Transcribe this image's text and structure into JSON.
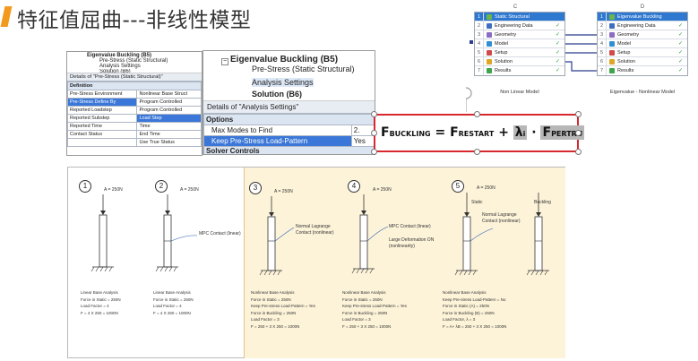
{
  "title": "特征值屈曲---非线性模型",
  "left_panel": {
    "tree": [
      "Eigenvalue Buckling (B5)",
      "Pre-Stress (Static Structural)",
      "Analysis Settings",
      "Solution (B6)"
    ],
    "details_title": "Details of \"Pre-Stress (Static Structural)\"",
    "section": "Definition",
    "rows": [
      [
        "Pre-Stress Environment",
        "Nonlinear Base Struct"
      ],
      [
        "Pre-Stress Define By",
        "Program Controlled"
      ],
      [
        "Reported Loadstep",
        "Program Controlled"
      ],
      [
        "Reported Substep",
        "Load Step"
      ],
      [
        "Reported Time",
        "Time"
      ],
      [
        "Contact Status",
        "End Time"
      ],
      [
        "",
        "Use True Status"
      ]
    ]
  },
  "middle_panel": {
    "tree": [
      "Eigenvalue Buckling (B5)",
      "Pre-Stress (Static Structural)",
      "Analysis Settings",
      "Solution (B6)"
    ],
    "details_title": "Details of \"Analysis Settings\"",
    "section": "Options",
    "rows": [
      [
        "Max Modes to Find",
        "2."
      ],
      [
        "Keep Pre-Stress Load-Pattern",
        "Yes"
      ]
    ],
    "section2": "Solver Controls"
  },
  "workflow": {
    "col_c": "C",
    "col_d": "D",
    "system_c": {
      "title": "Static Structural",
      "rows": [
        {
          "n": "1",
          "label": "Static Structural"
        },
        {
          "n": "2",
          "label": "Engineering Data"
        },
        {
          "n": "3",
          "label": "Geometry"
        },
        {
          "n": "4",
          "label": "Model"
        },
        {
          "n": "5",
          "label": "Setup"
        },
        {
          "n": "6",
          "label": "Solution"
        },
        {
          "n": "7",
          "label": "Results"
        }
      ],
      "caption": "Non Linear Model"
    },
    "system_d": {
      "rows": [
        {
          "n": "1",
          "label": "Eigenvalue Buckling"
        },
        {
          "n": "2",
          "label": "Engineering Data"
        },
        {
          "n": "3",
          "label": "Geometry"
        },
        {
          "n": "4",
          "label": "Model"
        },
        {
          "n": "5",
          "label": "Setup"
        },
        {
          "n": "6",
          "label": "Solution"
        },
        {
          "n": "7",
          "label": "Results"
        }
      ],
      "caption": "Eigenvalue - Nonlinear Model"
    }
  },
  "formula": {
    "F": "F",
    "sub1": "BUCKLING",
    "eq": "=",
    "F2": "F",
    "sub2": "RESTART",
    "plus": "+",
    "lambda": "λ",
    "sub3": "i",
    "dot": "·",
    "F3": "F",
    "sub4": "PERTRU"
  },
  "cases": [
    {
      "num": "1",
      "force": "A = 250N",
      "lines": [
        "Linear Base Analysis",
        "Force in Static = 250N",
        "Load Factor = 4",
        "F = 4 X 250 = 1000N"
      ]
    },
    {
      "num": "2",
      "force": "A = 250N",
      "note": "MPC Contact (linear)",
      "lines": [
        "Linear Base Analysis",
        "Force in Static = 250N",
        "Load Factor = 4",
        "F = 4 X 250 = 1000N"
      ]
    },
    {
      "num": "3",
      "force": "A = 250N",
      "note": "Normal Lagrange Contact (nonlinear)",
      "lines": [
        "Nonlinear Base Analysis",
        "Force in Static = 250N",
        "Keep Pre-stress Load-Pattern = Yes",
        "Force in Buckling = 250N",
        "Load Factor = 3",
        "F = 250 + 3 X 250 = 1000N"
      ]
    },
    {
      "num": "4",
      "force": "A = 250N",
      "note": "MPC Contact (linear)",
      "note2": "Large Deformation ON (nonlinearity)",
      "lines": [
        "Nonlinear Base Analysis",
        "Force in Static = 250N",
        "Keep Pre-stress Load-Pattern = Yes",
        "Force in Buckling = 250N",
        "Load Factor = 3",
        "F = 250 + 3 X 250 = 1000N"
      ]
    },
    {
      "num": "5",
      "force": "A = 250N",
      "static": "Static",
      "buckling": "Buckling",
      "note": "Normal Lagrange Contact (nonlinear)",
      "lines": [
        "Nonlinear Base Analysis",
        "Keep Pre-stress Load-Pattern = No",
        "Force in Static (A) = 250N",
        "Force in Buckling (B) = 250N",
        "Load Factor, λ = 3",
        "F = A+ λB = 250 + 3 X 250 = 1000N"
      ]
    }
  ],
  "colors": {
    "accent": "#f39a1e",
    "highlight": "#fdf3d9",
    "formula_border": "#d8282f"
  }
}
